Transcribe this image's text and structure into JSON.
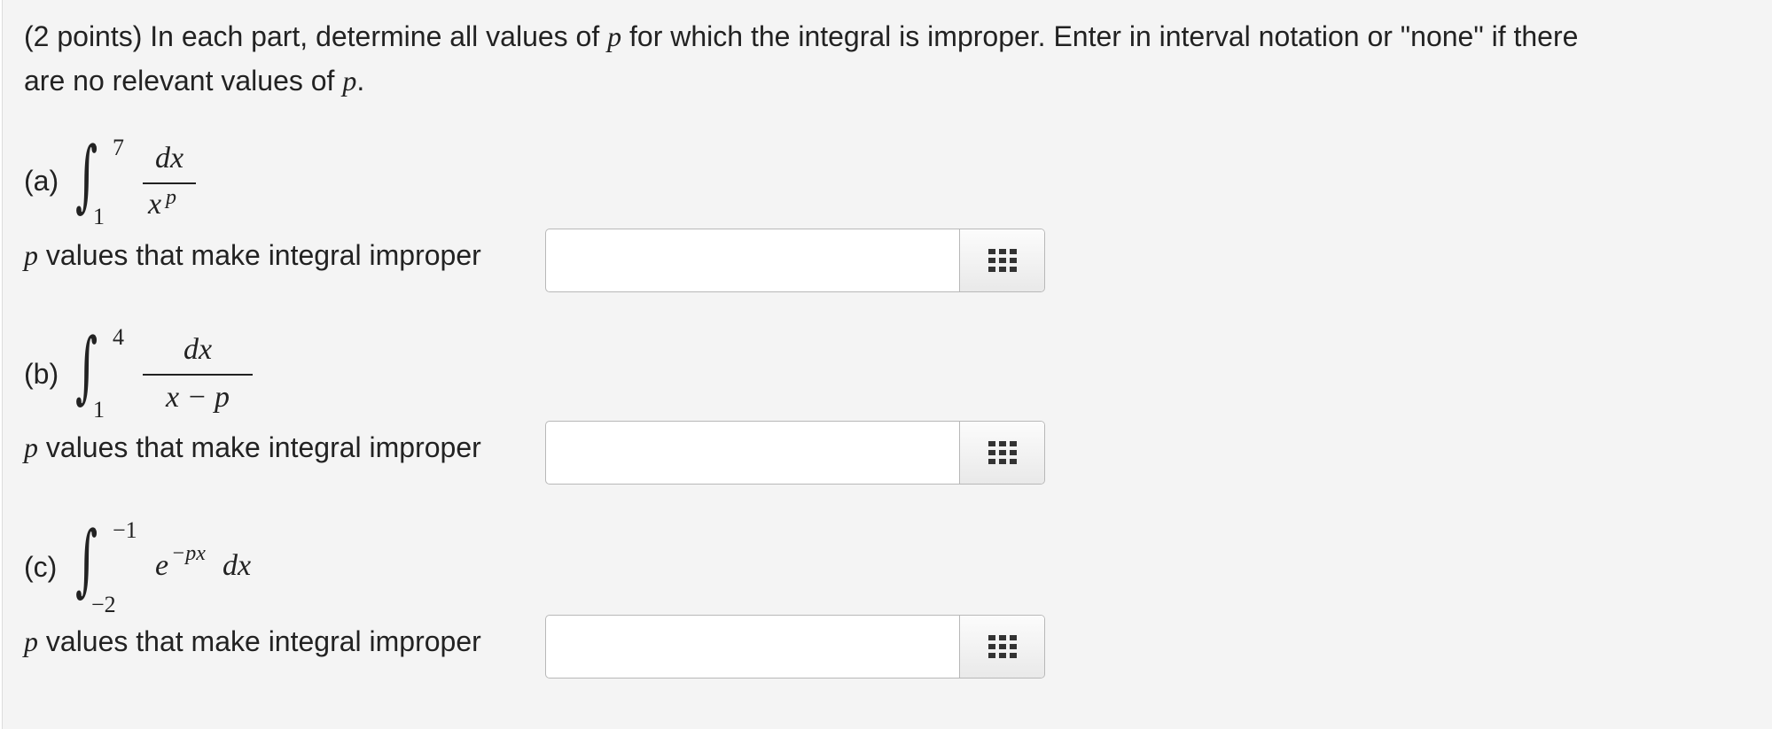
{
  "intro": {
    "text_a": "(2 points) In each part, determine all values of ",
    "p1": "p",
    "text_b": " for which the integral is improper. Enter in interval notation or \"none\" if there",
    "text_c": "are no relevant values of ",
    "p2": "p",
    "text_d": "."
  },
  "parts": [
    {
      "label": "(a)",
      "upper": "7",
      "lower": "1",
      "numerator": "dx",
      "denominator": "x",
      "den_sup": "p",
      "prompt_var": "p",
      "prompt_text": " values that make integral improper",
      "value": ""
    },
    {
      "label": "(b)",
      "upper": "4",
      "lower": "1",
      "numerator": "dx",
      "denominator": "x − p",
      "prompt_var": "p",
      "prompt_text": " values that make integral improper",
      "value": ""
    },
    {
      "label": "(c)",
      "upper": "−1",
      "lower": "−2",
      "base": "e",
      "exponent": "−px",
      "tail": "dx",
      "prompt_var": "p",
      "prompt_text": " values that make integral improper",
      "value": ""
    }
  ]
}
